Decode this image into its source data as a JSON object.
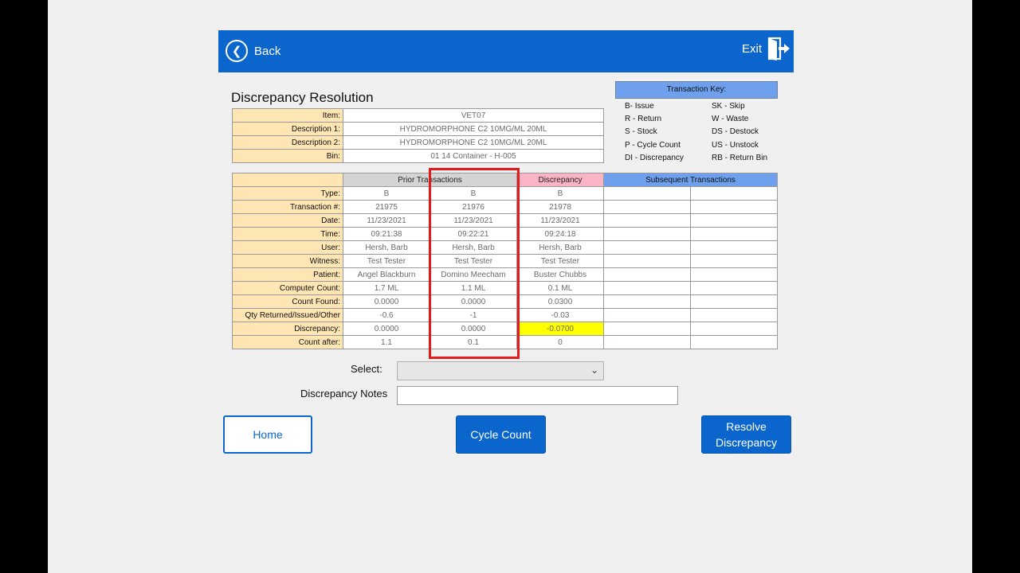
{
  "topbar": {
    "back_label": "Back",
    "exit_label": "Exit"
  },
  "page_title": "Discrepancy Resolution",
  "item_info": [
    {
      "label": "Item:",
      "value": "VET07"
    },
    {
      "label": "Description 1:",
      "value": "HYDROMORPHONE C2 10MG/ML 20ML"
    },
    {
      "label": "Description 2:",
      "value": "HYDROMORPHONE C2 10MG/ML 20ML"
    },
    {
      "label": "Bin:",
      "value": "01 14 Container - H-005"
    }
  ],
  "transaction_key": {
    "title": "Transaction Key:",
    "col1": [
      "B- Issue",
      "R - Return",
      "S - Stock",
      "P - Cycle Count",
      "DI - Discrepancy"
    ],
    "col2": [
      "SK - Skip",
      "W - Waste",
      "DS - Destock",
      "US - Unstock",
      "RB - Return Bin"
    ]
  },
  "transactions": {
    "headers": {
      "prior": "Prior Transactions",
      "discrepancy": "Discrepancy",
      "subsequent": "Subsequent Transactions"
    },
    "rows": [
      {
        "label": "Type:",
        "values": [
          "B",
          "B",
          "B",
          "",
          ""
        ]
      },
      {
        "label": "Transaction #:",
        "values": [
          "21975",
          "21976",
          "21978",
          "",
          ""
        ]
      },
      {
        "label": "Date:",
        "values": [
          "11/23/2021",
          "11/23/2021",
          "11/23/2021",
          "",
          ""
        ]
      },
      {
        "label": "Time:",
        "values": [
          "09:21:38",
          "09:22:21",
          "09:24:18",
          "",
          ""
        ]
      },
      {
        "label": "User:",
        "values": [
          "Hersh, Barb",
          "Hersh, Barb",
          "Hersh, Barb",
          "",
          ""
        ]
      },
      {
        "label": "Witness:",
        "values": [
          "Test Tester",
          "Test Tester",
          "Test Tester",
          "",
          ""
        ]
      },
      {
        "label": "Patient:",
        "values": [
          "Angel Blackburn",
          "Domino Meecham",
          "Buster Chubbs",
          "",
          ""
        ]
      },
      {
        "label": "Computer Count:",
        "values": [
          "1.7 ML",
          "1.1 ML",
          "0.1 ML",
          "",
          ""
        ]
      },
      {
        "label": "Count Found:",
        "values": [
          "0.0000",
          "0.0000",
          "0.0300",
          "",
          ""
        ]
      },
      {
        "label": "Qty Returned/Issued/Other",
        "values": [
          "-0.6",
          "-1",
          "-0.03",
          "",
          ""
        ]
      },
      {
        "label": "Discrepancy:",
        "values": [
          "0.0000",
          "0.0000",
          "-0.0700",
          "",
          ""
        ]
      },
      {
        "label": "Count after:",
        "values": [
          "1.1",
          "0.1",
          "0",
          "",
          ""
        ]
      }
    ],
    "highlight_color": "#ffff00",
    "selection_color": "#e31b1b"
  },
  "form": {
    "select_label": "Select:",
    "select_value": "",
    "notes_label": "Discrepancy Notes",
    "notes_value": ""
  },
  "buttons": {
    "home": "Home",
    "cycle_count": "Cycle Count",
    "resolve_line1": "Resolve",
    "resolve_line2": "Discrepancy"
  },
  "colors": {
    "brand": "#0a66cc",
    "label_bg": "#fde5b4",
    "subsequent_header": "#6ea0ee",
    "discrepancy_header": "#f9b4c6"
  }
}
